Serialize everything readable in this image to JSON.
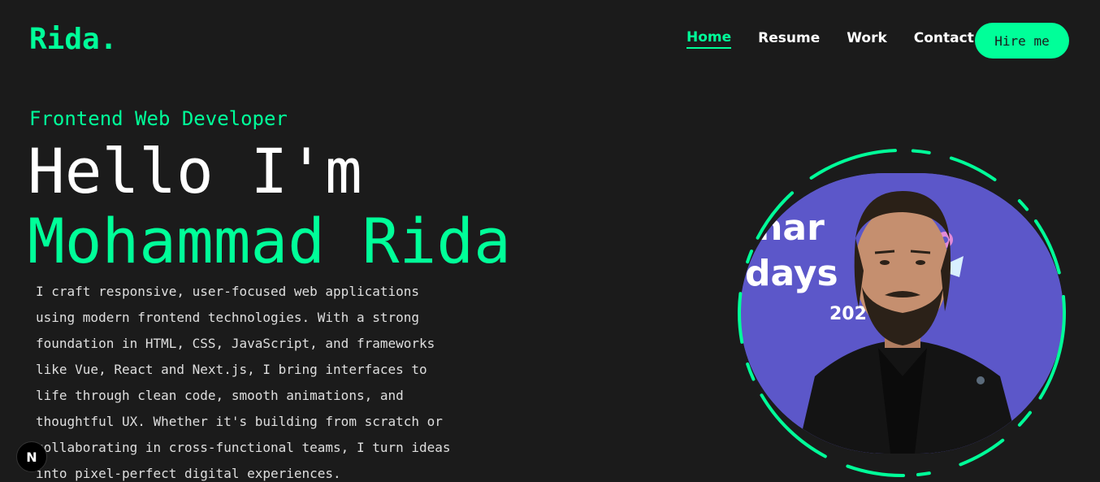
{
  "header": {
    "logo_text": "Rida",
    "logo_dot": ".",
    "nav": [
      {
        "label": "Home",
        "active": true
      },
      {
        "label": "Resume",
        "active": false
      },
      {
        "label": "Work",
        "active": false
      },
      {
        "label": "Contact",
        "active": false
      }
    ],
    "hire_label": "Hire me"
  },
  "hero": {
    "role": "Frontend Web Developer",
    "greeting": "Hello I'm",
    "name": "Mohammad Rida",
    "bio": "I craft responsive, user-focused web applications using modern frontend technologies. With a strong foundation in HTML, CSS, JavaScript, and frameworks like Vue, React and Next.js, I bring interfaces to life through clean code, smooth animations, and thoughtful UX. Whether it's building from scratch or collaborating in cross-functional teams, I turn ideas into pixel-perfect digital experiences."
  },
  "photo": {
    "icon": "profile-photo",
    "backdrop_text_1": "inar",
    "backdrop_text_2": "days",
    "backdrop_text_3": "202"
  },
  "badge": {
    "label": "N",
    "icon": "nextjs-icon"
  },
  "colors": {
    "accent": "#00ff99",
    "background": "#1b1b1b",
    "text": "#ffffff",
    "photo_backdrop": "#5c57c9"
  }
}
